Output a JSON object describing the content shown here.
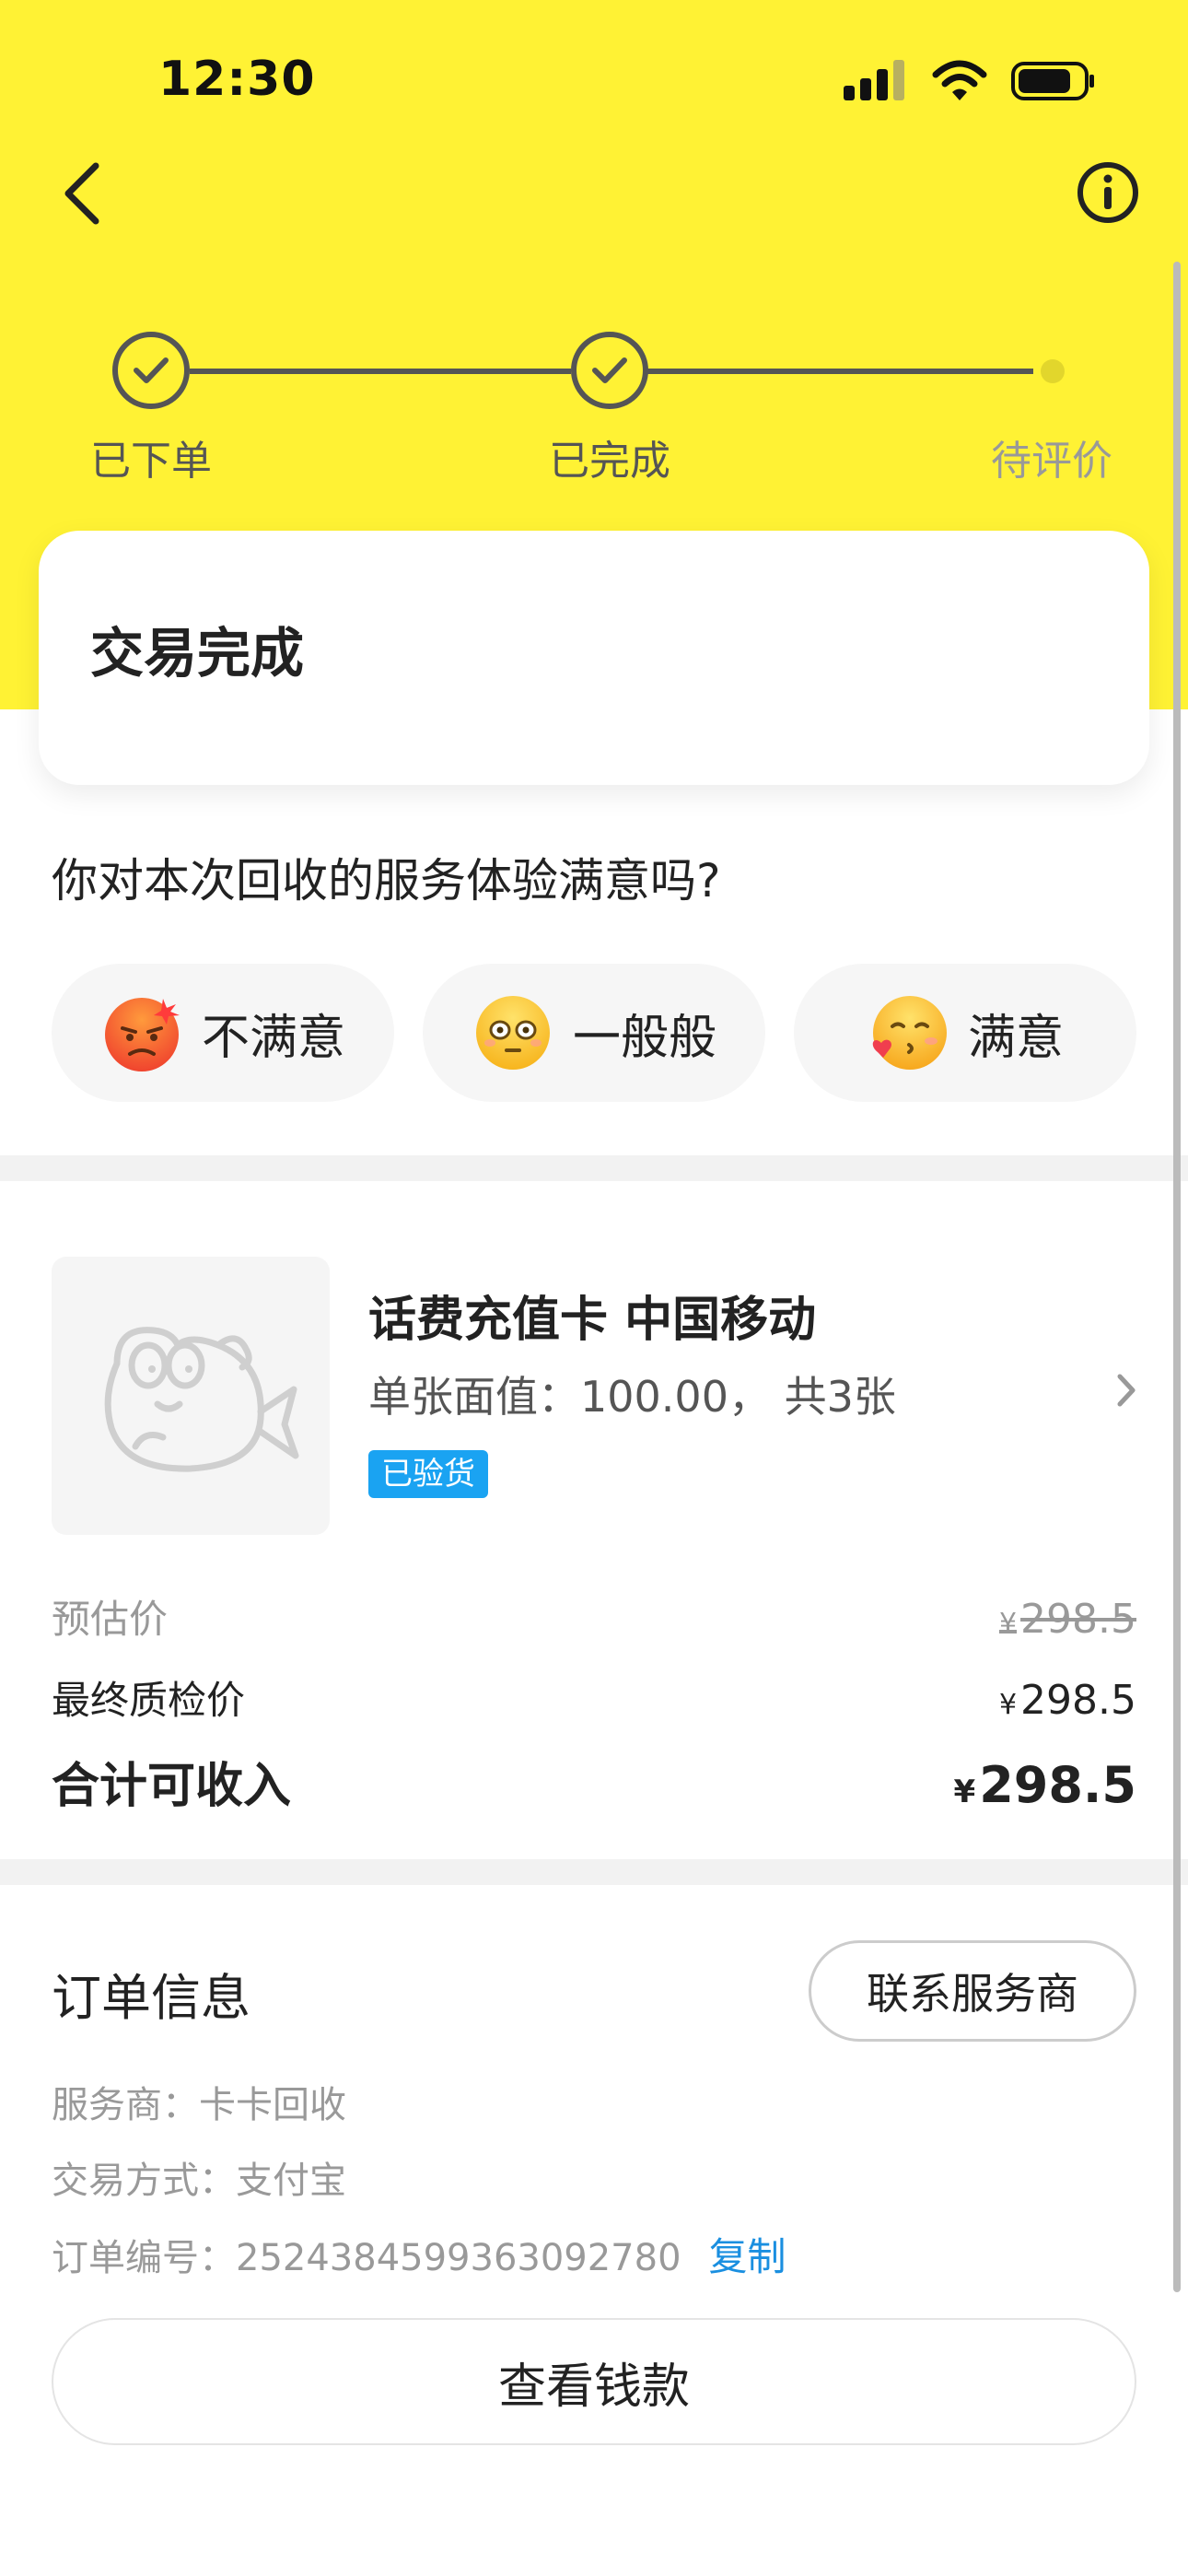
{
  "status_bar": {
    "time": "12:30"
  },
  "progress": {
    "steps": [
      {
        "label": "已下单",
        "state": "done"
      },
      {
        "label": "已完成",
        "state": "done"
      },
      {
        "label": "待评价",
        "state": "pending"
      }
    ]
  },
  "status_card": {
    "title": "交易完成"
  },
  "feedback": {
    "question": "你对本次回收的服务体验满意吗?",
    "options": [
      {
        "label": "不满意",
        "icon": "angry-face-icon"
      },
      {
        "label": "一般般",
        "icon": "neutral-face-icon"
      },
      {
        "label": "满意",
        "icon": "kissing-face-icon"
      }
    ]
  },
  "product": {
    "title": "话费充值卡 中国移动",
    "subtitle": "单张面值：100.00， 共3张",
    "badge": "已验货",
    "thumbnail_icon": "fish-mascot-icon"
  },
  "prices": {
    "estimate_label": "预估价",
    "estimate_currency": "¥",
    "estimate_value": "298.5",
    "final_label": "最终质检价",
    "final_currency": "¥",
    "final_value": "298.5",
    "total_label": "合计可收入",
    "total_currency": "¥",
    "total_value": "298.5"
  },
  "order": {
    "title": "订单信息",
    "contact_label": "联系服务商",
    "provider": "服务商：卡卡回收",
    "payment": "交易方式：支付宝",
    "order_no": "订单编号：2524384599363092780",
    "copy_label": "复制"
  },
  "footer": {
    "view_funds_label": "查看钱款"
  },
  "colors": {
    "header_yellow": "#FFF234",
    "badge_blue": "#1AA3F2",
    "link_blue": "#1A8FE0"
  }
}
